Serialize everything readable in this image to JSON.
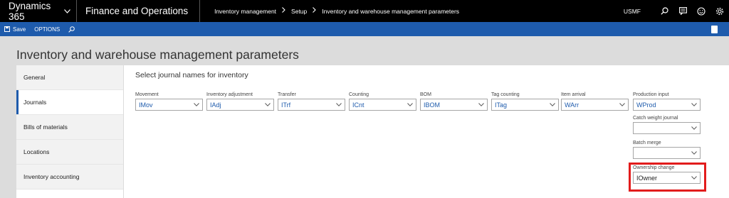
{
  "topbar": {
    "brand": "Dynamics 365",
    "app": "Finance and Operations",
    "breadcrumb": [
      "Inventory management",
      "Setup",
      "Inventory and warehouse management parameters"
    ],
    "company": "USMF"
  },
  "actionbar": {
    "save_label": "Save",
    "options_label": "OPTIONS"
  },
  "page": {
    "title": "Inventory and warehouse management parameters"
  },
  "tabs": [
    {
      "label": "General",
      "active": false
    },
    {
      "label": "Journals",
      "active": true
    },
    {
      "label": "Bills of materials",
      "active": false
    },
    {
      "label": "Locations",
      "active": false
    },
    {
      "label": "Inventory accounting",
      "active": false
    }
  ],
  "section": {
    "title": "Select journal names for inventory"
  },
  "fields": [
    {
      "label": "Movement",
      "value": "IMov"
    },
    {
      "label": "Inventory adjustment",
      "value": "IAdj"
    },
    {
      "label": "Transfer",
      "value": "ITrf"
    },
    {
      "label": "Counting",
      "value": "ICnt"
    },
    {
      "label": "BOM",
      "value": "IBOM"
    },
    {
      "label": "Tag counting",
      "value": "ITag"
    },
    {
      "label": "Item arrival",
      "value": "WArr"
    },
    {
      "label": "Production input",
      "value": "WProd"
    },
    {
      "label": "Catch weight journal",
      "value": ""
    },
    {
      "label": "Batch merge",
      "value": ""
    },
    {
      "label": "Ownership change",
      "value": "IOwner"
    }
  ],
  "colors": {
    "accent": "#1e5bac",
    "highlight": "#e21c1c"
  }
}
